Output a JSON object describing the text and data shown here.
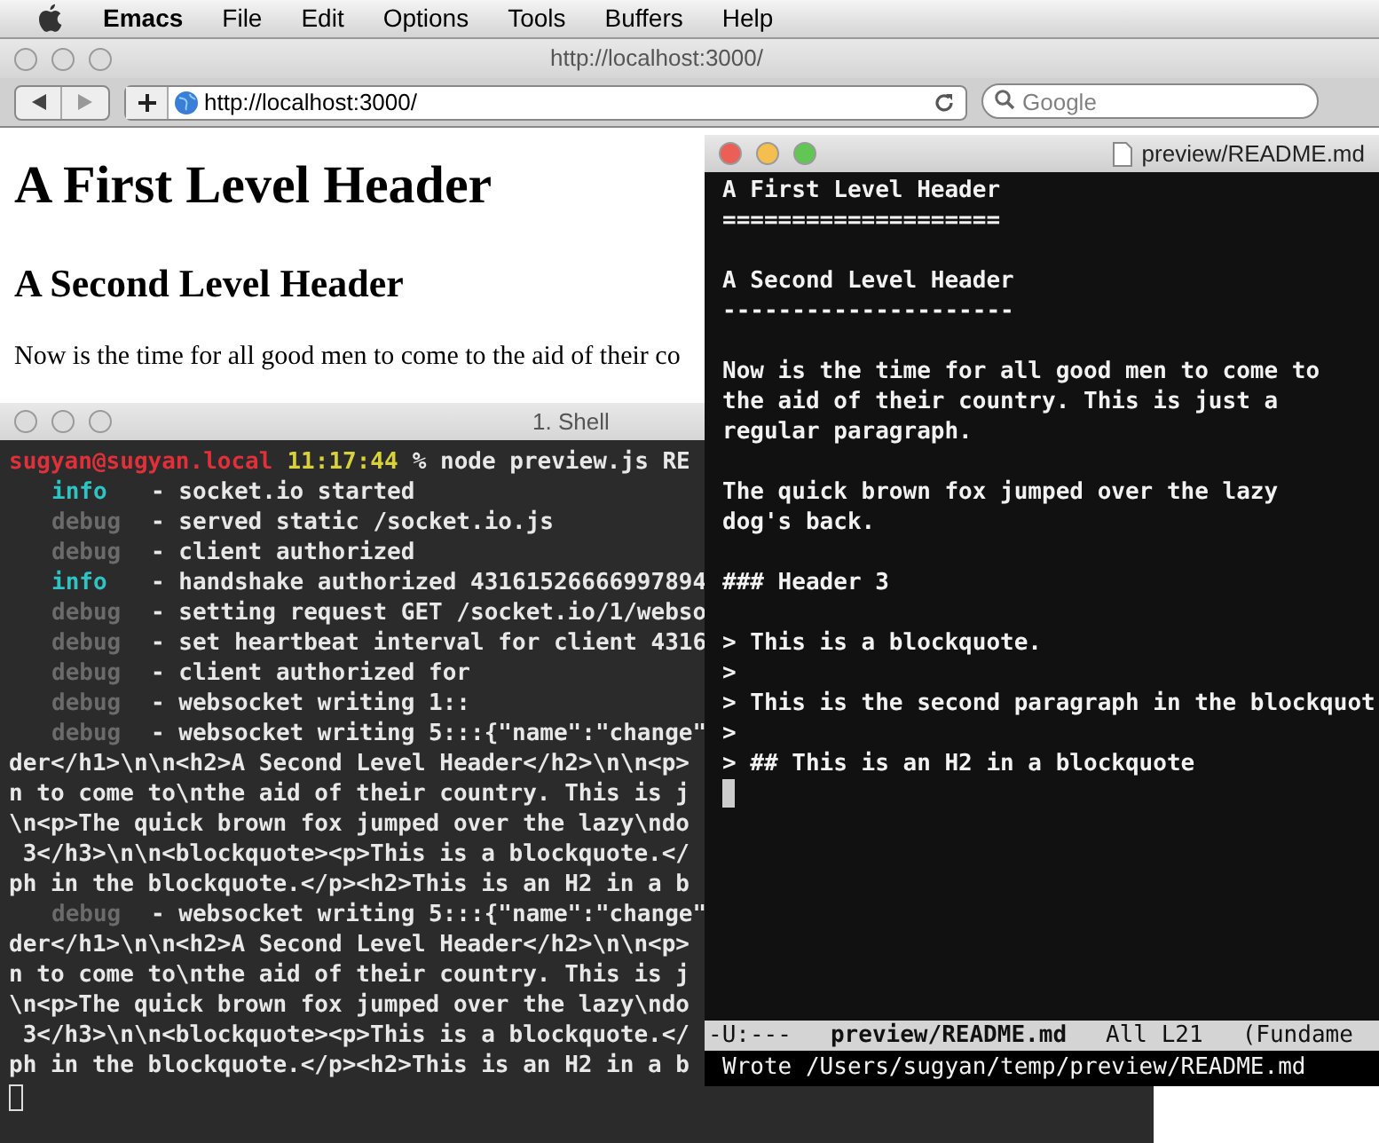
{
  "menu_bar": {
    "app": "Emacs",
    "items": [
      "File",
      "Edit",
      "Options",
      "Tools",
      "Buffers",
      "Help"
    ]
  },
  "browser": {
    "title": "http://localhost:3000/",
    "active": false,
    "url": "http://localhost:3000/",
    "search_placeholder": "Google",
    "page": {
      "h1": "A First Level Header",
      "h2": "A Second Level Header",
      "paragraph": "Now is the time for all good men to come to the aid of their co"
    }
  },
  "shell": {
    "title": "1. Shell",
    "active": false,
    "lines": [
      {
        "kind": "prompt",
        "user": "sugyan@sugyan.local",
        "time": "11:17:44",
        "command": "% node preview.js RE"
      },
      {
        "kind": "log",
        "level": "info",
        "message": "- socket.io started"
      },
      {
        "kind": "log",
        "level": "debug",
        "message": "- served static /socket.io.js"
      },
      {
        "kind": "log",
        "level": "debug",
        "message": "- client authorized"
      },
      {
        "kind": "log",
        "level": "info",
        "message": "- handshake authorized 43161526666997894"
      },
      {
        "kind": "log",
        "level": "debug",
        "message": "- setting request GET /socket.io/1/webso"
      },
      {
        "kind": "log",
        "level": "debug",
        "message": "- set heartbeat interval for client 4316"
      },
      {
        "kind": "log",
        "level": "debug",
        "message": "- client authorized for"
      },
      {
        "kind": "log",
        "level": "debug",
        "message": "- websocket writing 1::"
      },
      {
        "kind": "log",
        "level": "debug",
        "message": "- websocket writing 5:::{\"name\":\"change\""
      },
      {
        "kind": "raw",
        "text": "der</h1>\\n\\n<h2>A Second Level Header</h2>\\n\\n<p>"
      },
      {
        "kind": "raw",
        "text": "n to come to\\nthe aid of their country. This is j"
      },
      {
        "kind": "raw",
        "text": "\\n<p>The quick brown fox jumped over the lazy\\ndo"
      },
      {
        "kind": "raw",
        "text": " 3</h3>\\n\\n<blockquote><p>This is a blockquote.</"
      },
      {
        "kind": "raw",
        "text": "ph in the blockquote.</p><h2>This is an H2 in a b"
      },
      {
        "kind": "log",
        "level": "debug",
        "message": "- websocket writing 5:::{\"name\":\"change\""
      },
      {
        "kind": "raw",
        "text": "der</h1>\\n\\n<h2>A Second Level Header</h2>\\n\\n<p>"
      },
      {
        "kind": "raw",
        "text": "n to come to\\nthe aid of their country. This is j"
      },
      {
        "kind": "raw",
        "text": "\\n<p>The quick brown fox jumped over the lazy\\ndo"
      },
      {
        "kind": "raw",
        "text": " 3</h3>\\n\\n<blockquote><p>This is a blockquote.</"
      },
      {
        "kind": "raw",
        "text": "ph in the blockquote.</p><h2>This is an H2 in a b"
      }
    ]
  },
  "editor": {
    "title": "preview/README.md",
    "active": true,
    "blocks": [
      [
        "A First Level Header",
        "===================="
      ],
      [
        "A Second Level Header",
        "---------------------"
      ],
      [
        "Now is the time for all good men to come to",
        "the aid of their country. This is just a",
        "regular paragraph."
      ],
      [
        "The quick brown fox jumped over the lazy",
        "dog's back."
      ],
      [
        "### Header 3"
      ],
      [
        "> This is a blockquote.",
        ">",
        "> This is the second paragraph in the blockquot",
        ">",
        "> ## This is an H2 in a blockquote"
      ]
    ],
    "mode_line": {
      "status": "-U:---",
      "buffer": "preview/README.md",
      "position": "All L21",
      "mode": "(Fundame"
    },
    "echo_area": "Wrote /Users/sugyan/temp/preview/README.md"
  }
}
